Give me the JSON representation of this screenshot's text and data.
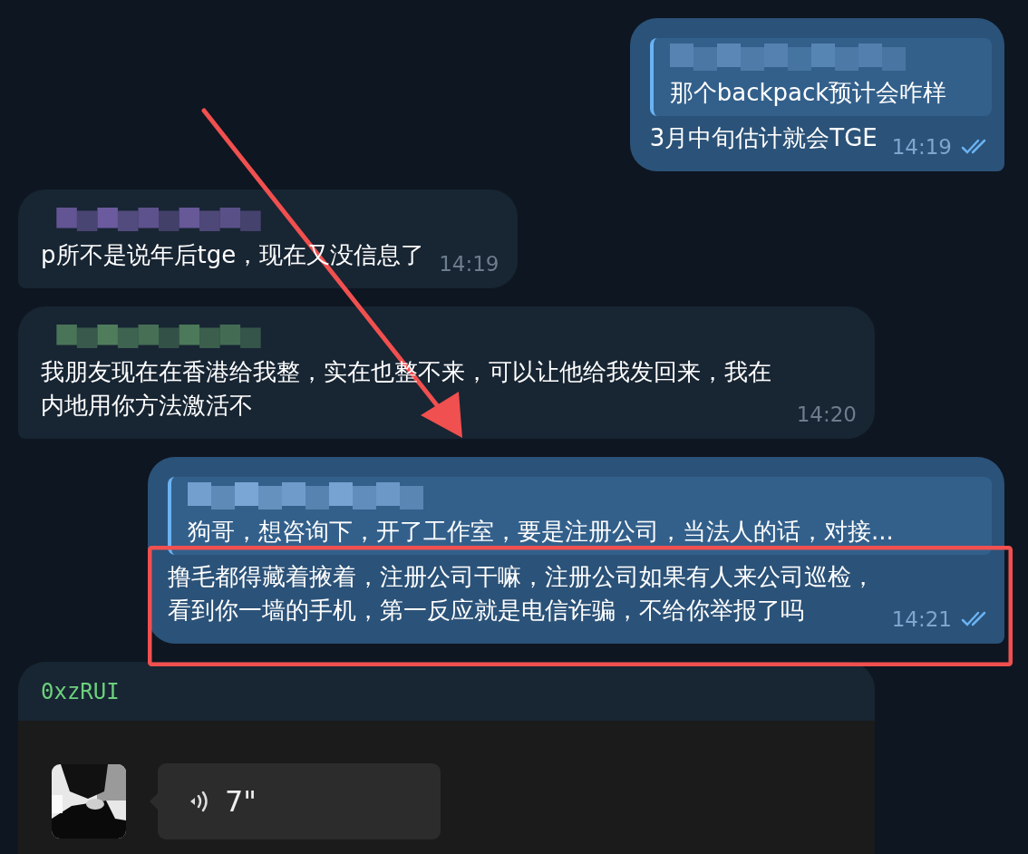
{
  "messages": [
    {
      "kind": "text",
      "outgoing": true,
      "reply": {
        "color": "#5a87b5",
        "text": "那个backpack预计会咋样"
      },
      "text": "3月中旬估计就会TGE",
      "time": "14:19",
      "read": true
    },
    {
      "kind": "text",
      "outgoing": false,
      "color": "#6b5b9e",
      "text": "p所不是说年后tge，现在又没信息了",
      "time": "14:19"
    },
    {
      "kind": "text",
      "outgoing": false,
      "color": "#4f7d5c",
      "text": "我朋友现在在香港给我整，实在也整不来，可以让他给我发回来，我在内地用你方法激活不",
      "time": "14:20"
    },
    {
      "kind": "text",
      "outgoing": true,
      "reply": {
        "color": "#7aa6d6",
        "text": "狗哥，想咨询下，开了工作室，要是注册公司，当法人的话，对接..."
      },
      "text": "撸毛都得藏着掖着，注册公司干嘛，注册公司如果有人来公司巡检，看到你一墙的手机，第一反应就是电信诈骗，不给你举报了吗",
      "time": "14:21",
      "read": true
    },
    {
      "kind": "voice",
      "outgoing": false,
      "forwarded_from": "0xzRUI",
      "duration": "7\""
    }
  ]
}
